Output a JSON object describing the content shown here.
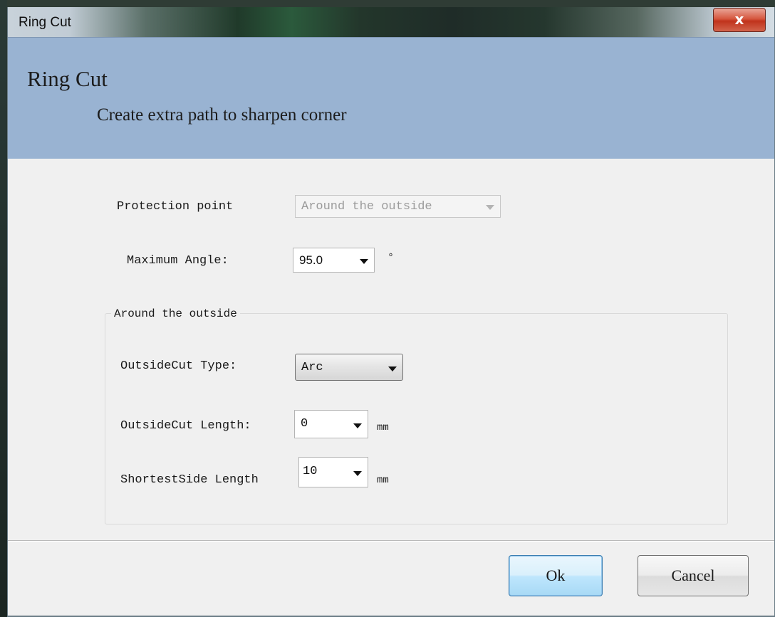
{
  "window": {
    "title": "Ring Cut",
    "close_label": "x"
  },
  "header": {
    "title": "Ring Cut",
    "subtitle": "Create extra path to sharpen corner"
  },
  "form": {
    "protection_point": {
      "label": "Protection point",
      "value": "Around the outside",
      "enabled": false
    },
    "maximum_angle": {
      "label": "Maximum Angle:",
      "value": "95.0",
      "unit": "°"
    },
    "group": {
      "title": "Around the outside",
      "outside_cut_type": {
        "label": "OutsideCut Type:",
        "value": "Arc"
      },
      "outside_cut_length": {
        "label": "OutsideCut Length:",
        "value": "0",
        "unit": "mm"
      },
      "shortest_side_length": {
        "label": "ShortestSide Length",
        "value": "10",
        "unit": "mm"
      }
    }
  },
  "buttons": {
    "ok": "Ok",
    "cancel": "Cancel"
  },
  "colors": {
    "header_band": "#99b3d2",
    "dialog_bg": "#f0f0f0",
    "close_button": "#c7452c"
  }
}
